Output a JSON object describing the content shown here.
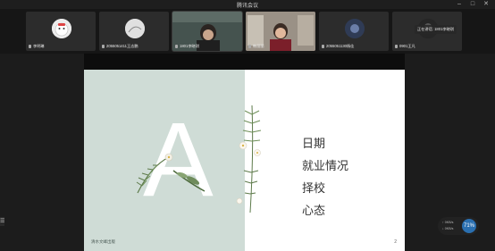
{
  "window": {
    "title": "腾讯会议",
    "minimize": "–",
    "maximize": "□",
    "close": "✕"
  },
  "participants": [
    {
      "name": "李明琳",
      "avatar_color": "#e6e6e6",
      "active": false
    },
    {
      "name": "2055051411王志鹏",
      "avatar_color": "#cfcfcf",
      "active": false
    },
    {
      "name": "1801李晓琪",
      "avatar_color": "#3a4f52",
      "active": true
    },
    {
      "name": "韩丽丽",
      "avatar_color": "#b8a898",
      "active": false
    },
    {
      "name": "2055051130杨佳",
      "avatar_color": "#334466",
      "active": false
    },
    {
      "name": "0901王凡",
      "avatar_color": "#2a2a2a",
      "active": false
    }
  ],
  "speaking_indicator": "正在讲话: 1801李晓琪",
  "slide": {
    "big_letter": "A",
    "items": [
      "日期",
      "就业情况",
      "择校",
      "心态"
    ],
    "footer": "清水文峰出版",
    "page": "2"
  },
  "side_handle_label": "☰",
  "network": {
    "upload": "↑ 0KB/s",
    "download": "↓ 0KB/s",
    "percent": "71%"
  }
}
